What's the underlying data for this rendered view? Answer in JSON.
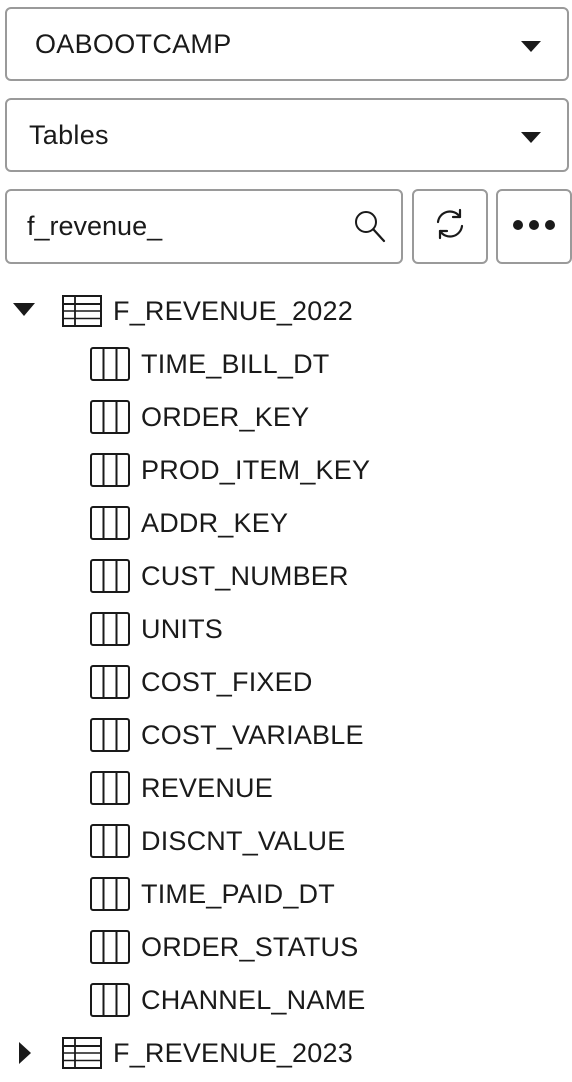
{
  "schema_select": {
    "value": "OABOOTCAMP"
  },
  "object_type_select": {
    "value": "Tables"
  },
  "search": {
    "value": "f_revenue_"
  },
  "tree": {
    "tables": [
      {
        "name": "F_REVENUE_2022",
        "expanded": true,
        "columns": [
          "TIME_BILL_DT",
          "ORDER_KEY",
          "PROD_ITEM_KEY",
          "ADDR_KEY",
          "CUST_NUMBER",
          "UNITS",
          "COST_FIXED",
          "COST_VARIABLE",
          "REVENUE",
          "DISCNT_VALUE",
          "TIME_PAID_DT",
          "ORDER_STATUS",
          "CHANNEL_NAME"
        ]
      },
      {
        "name": "F_REVENUE_2023",
        "expanded": false,
        "columns": []
      }
    ]
  }
}
